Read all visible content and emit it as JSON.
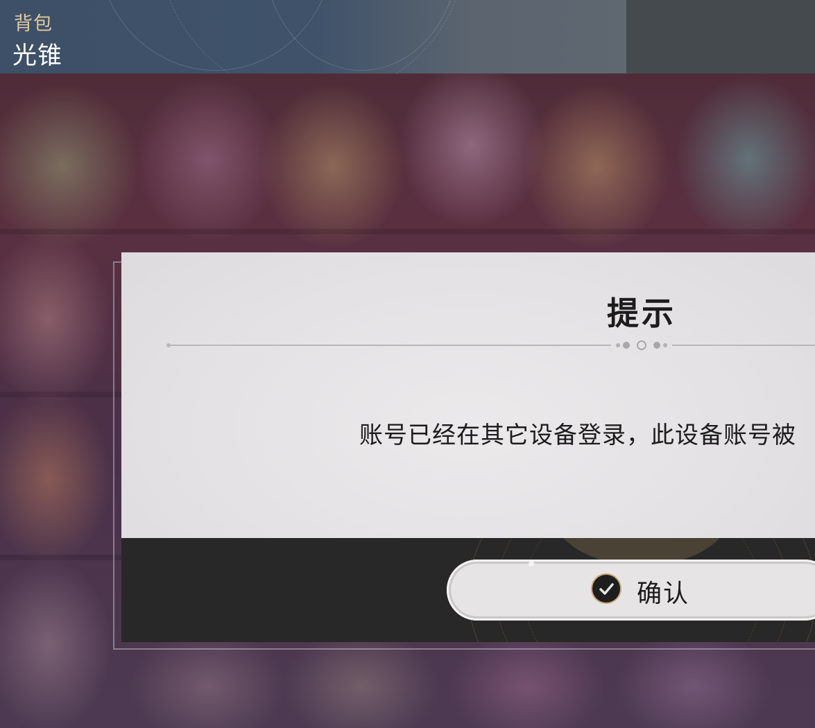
{
  "header": {
    "subtitle": "背包",
    "title": "光锥"
  },
  "dialog": {
    "title": "提示",
    "message": "账号已经在其它设备登录，此设备账号被",
    "confirm_label": "确认",
    "confirm_icon": "check-circle-icon"
  },
  "colors": {
    "header_subtitle": "#e2c9a0",
    "dialog_body": "#e6e4e5",
    "dialog_footer": "#282828",
    "check_ring": "#c9a874"
  }
}
